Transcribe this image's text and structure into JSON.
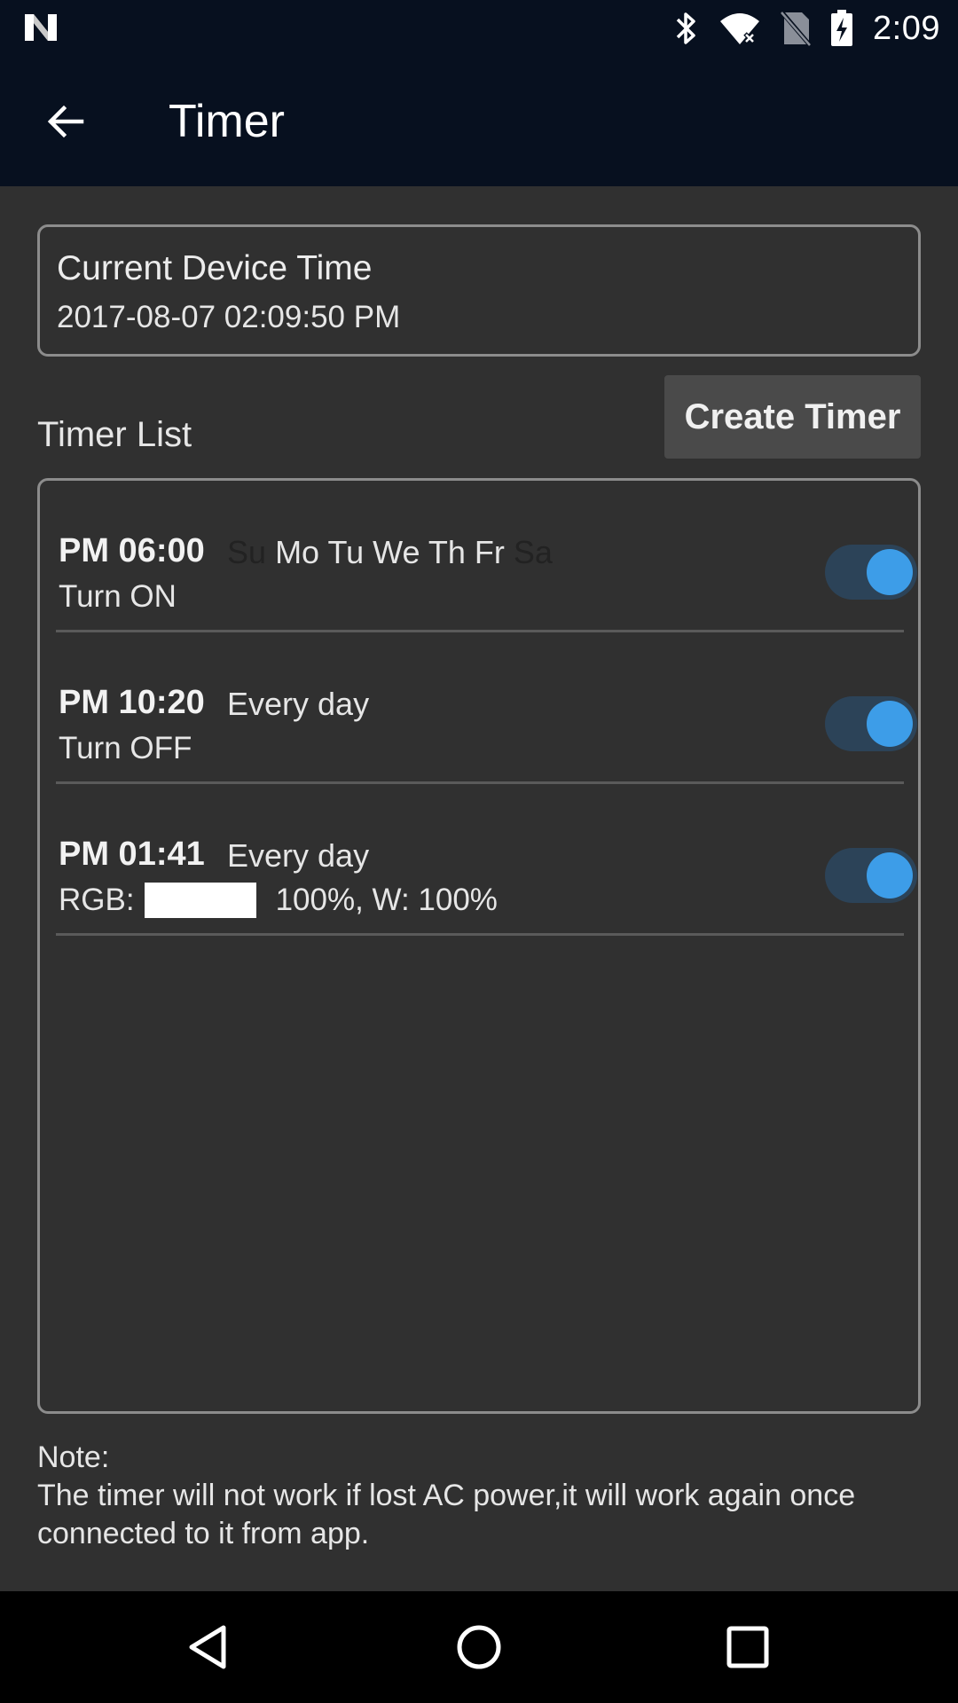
{
  "status_bar": {
    "time": "2:09",
    "icons": [
      "notification-n-icon",
      "bluetooth-icon",
      "wifi-icon",
      "no-sim-icon",
      "battery-charging-icon"
    ]
  },
  "app_bar": {
    "title": "Timer",
    "back_icon": "arrow-back-icon"
  },
  "device_time": {
    "label": "Current Device Time",
    "value": "2017-08-07 02:09:50 PM"
  },
  "timer_list": {
    "label": "Timer List",
    "create_button": "Create Timer",
    "timers": [
      {
        "time": "PM 06:00",
        "days": [
          {
            "label": "Su",
            "active": false
          },
          {
            "label": "Mo",
            "active": true
          },
          {
            "label": "Tu",
            "active": true
          },
          {
            "label": "We",
            "active": true
          },
          {
            "label": "Th",
            "active": true
          },
          {
            "label": "Fr",
            "active": true
          },
          {
            "label": "Sa",
            "active": false
          }
        ],
        "action": "Turn ON",
        "enabled": true
      },
      {
        "time": "PM 10:20",
        "repeat": "Every day",
        "action": "Turn OFF",
        "enabled": true
      },
      {
        "time": "PM 01:41",
        "repeat": "Every day",
        "action_prefix": "RGB:",
        "swatch_color": "#ffffff",
        "action_suffix": "100%, W: 100%",
        "enabled": true
      }
    ]
  },
  "note": {
    "title": "Note:",
    "text": "The timer will not work if lost AC power,it will work again once connected to it from app."
  },
  "colors": {
    "header_bg": "#07101f",
    "content_bg": "#303030",
    "toggle_thumb": "#3d9de8",
    "toggle_track": "#2c4358",
    "button_bg": "#4a4a4a"
  },
  "nav_bar": {
    "icons": [
      "back-triangle-icon",
      "home-circle-icon",
      "recents-square-icon"
    ]
  }
}
